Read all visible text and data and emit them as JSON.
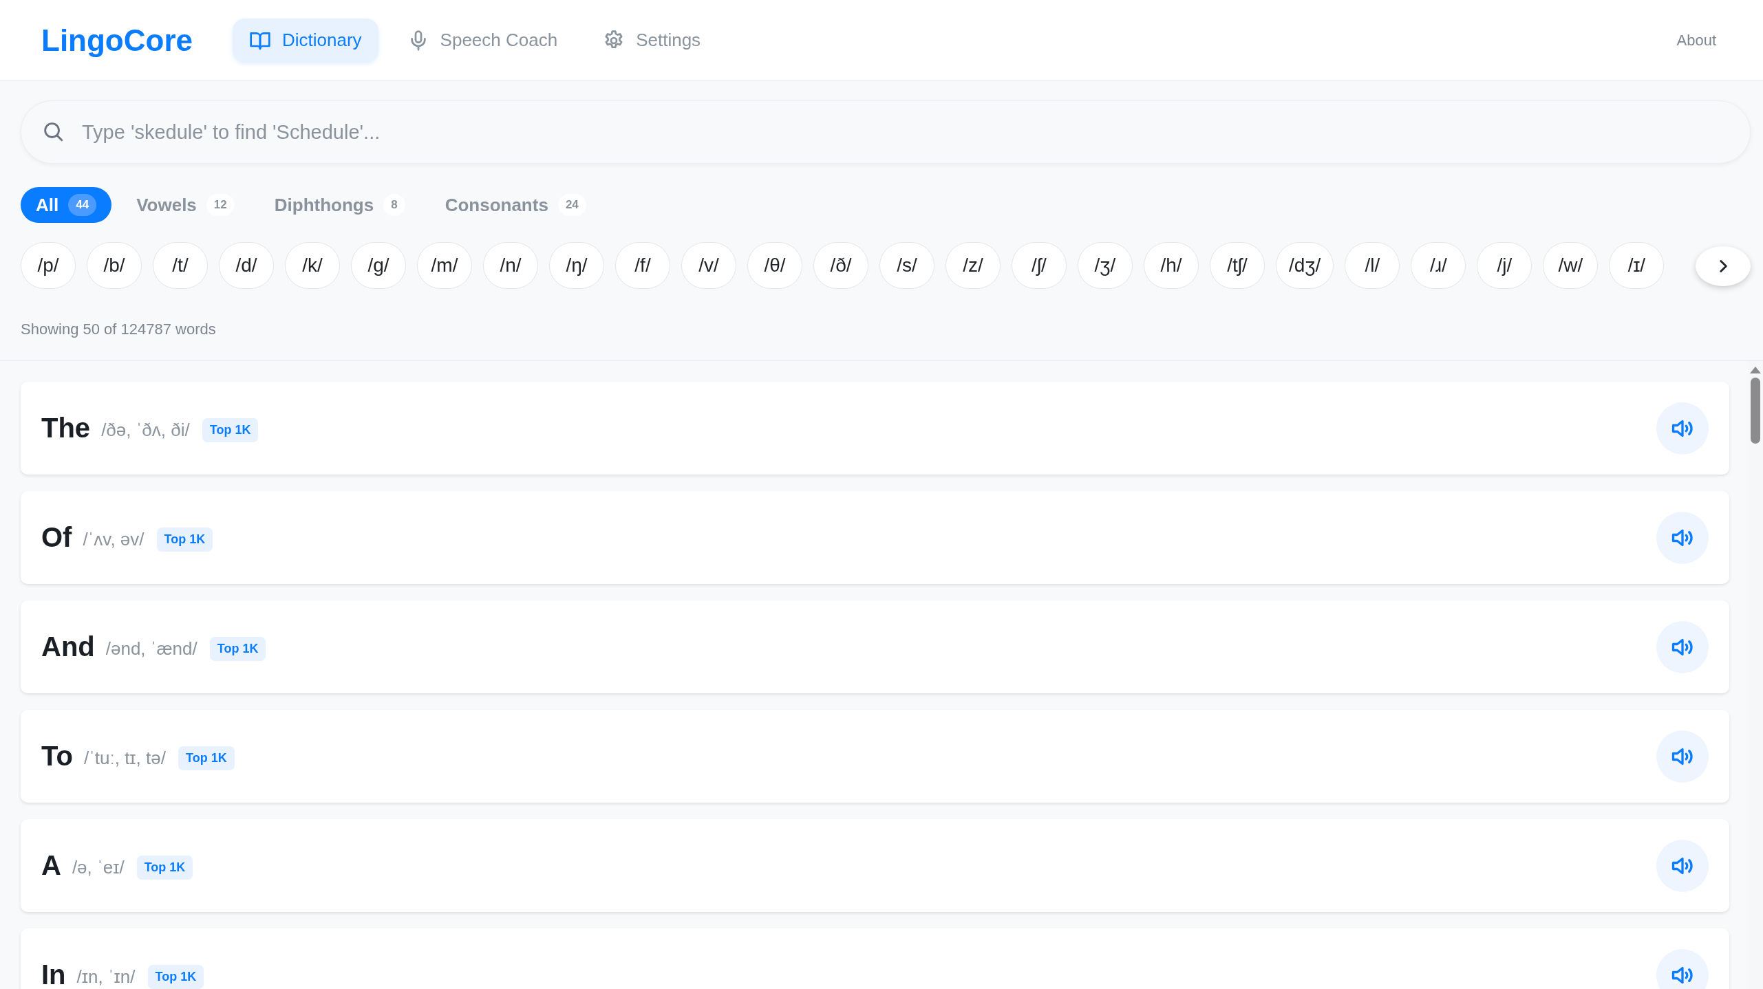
{
  "header": {
    "logo": "LingoCore",
    "nav": [
      {
        "kind": "dictionary",
        "label": "Dictionary",
        "selected": true
      },
      {
        "kind": "mic",
        "label": "Speech Coach",
        "selected": false
      },
      {
        "kind": "gear",
        "label": "Settings",
        "selected": false
      }
    ],
    "about": "About"
  },
  "search": {
    "placeholder": "Type 'skedule' to find 'Schedule'..."
  },
  "filters": [
    {
      "label": "All",
      "count": "44",
      "selected": true
    },
    {
      "label": "Vowels",
      "count": "12",
      "selected": false
    },
    {
      "label": "Diphthongs",
      "count": "8",
      "selected": false
    },
    {
      "label": "Consonants",
      "count": "24",
      "selected": false
    }
  ],
  "phonemes": [
    "/p/",
    "/b/",
    "/t/",
    "/d/",
    "/k/",
    "/g/",
    "/m/",
    "/n/",
    "/ŋ/",
    "/f/",
    "/v/",
    "/θ/",
    "/ð/",
    "/s/",
    "/z/",
    "/ʃ/",
    "/ʒ/",
    "/h/",
    "/tʃ/",
    "/dʒ/",
    "/l/",
    "/ɹ/",
    "/j/",
    "/w/",
    "/ɪ/"
  ],
  "summary": "Showing 50 of 124787 words",
  "words": [
    {
      "word": "The",
      "ipa": "/ðə, ˈðʌ, ði/",
      "badge": "Top 1K"
    },
    {
      "word": "Of",
      "ipa": "/ˈʌv, əv/",
      "badge": "Top 1K"
    },
    {
      "word": "And",
      "ipa": "/ənd, ˈænd/",
      "badge": "Top 1K"
    },
    {
      "word": "To",
      "ipa": "/ˈtuː, tɪ, tə/",
      "badge": "Top 1K"
    },
    {
      "word": "A",
      "ipa": "/ə, ˈeɪ/",
      "badge": "Top 1K"
    },
    {
      "word": "In",
      "ipa": "/ɪn, ˈɪn/",
      "badge": "Top 1K"
    }
  ]
}
